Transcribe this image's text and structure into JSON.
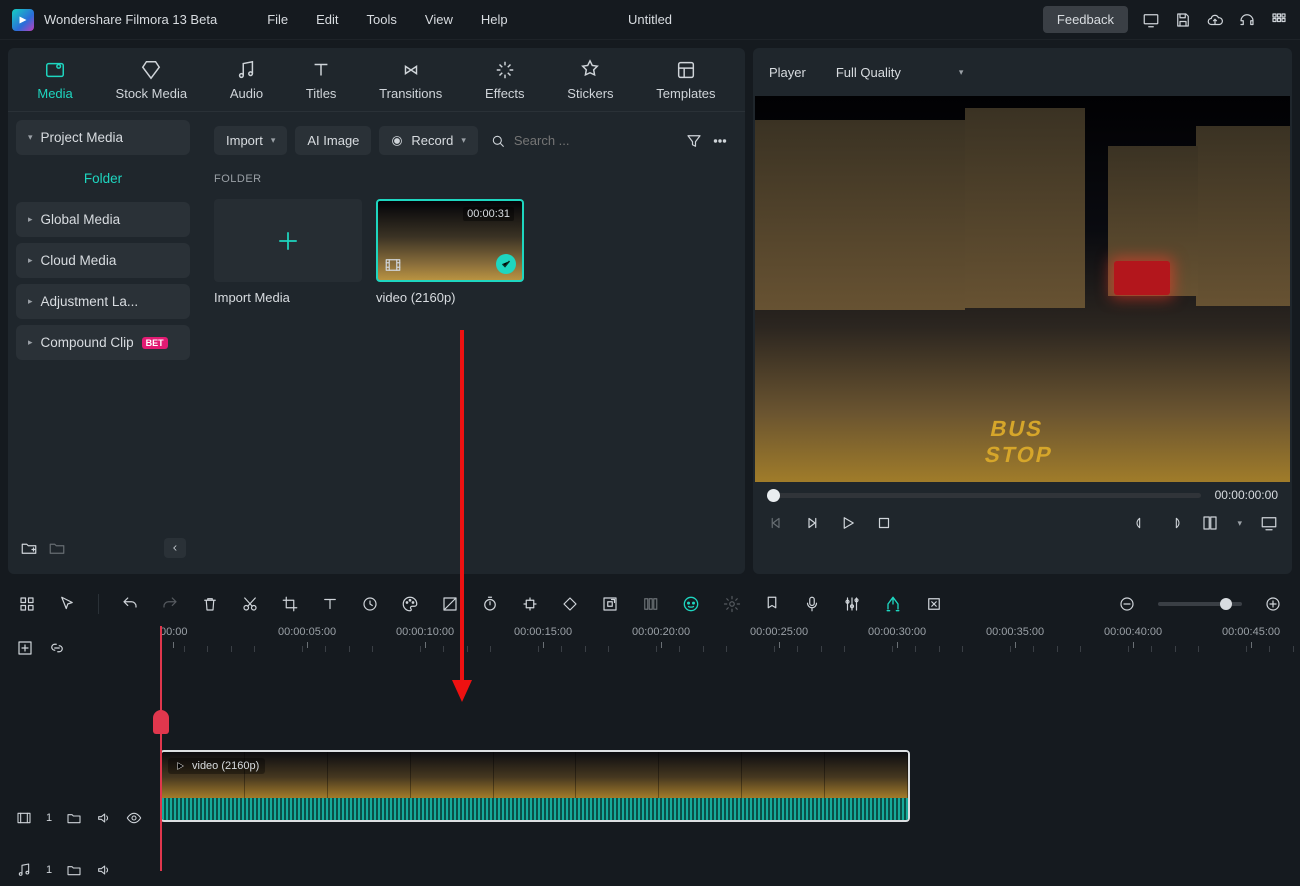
{
  "app_title": "Wondershare Filmora 13 Beta",
  "menus": {
    "file": "File",
    "edit": "Edit",
    "tools": "Tools",
    "view": "View",
    "help": "Help"
  },
  "document_name": "Untitled",
  "feedback_label": "Feedback",
  "tabs": {
    "media": "Media",
    "stock": "Stock Media",
    "audio": "Audio",
    "titles": "Titles",
    "transitions": "Transitions",
    "effects": "Effects",
    "stickers": "Stickers",
    "templates": "Templates"
  },
  "sidebar": {
    "project": "Project Media",
    "folder": "Folder",
    "global": "Global Media",
    "cloud": "Cloud Media",
    "adjust": "Adjustment La...",
    "compound": "Compound Clip",
    "compound_badge": "BET"
  },
  "browser": {
    "import": "Import",
    "ai_image": "AI Image",
    "record": "Record",
    "search_placeholder": "Search ...",
    "section": "FOLDER",
    "import_tile": "Import Media",
    "clip": {
      "duration": "00:00:31",
      "name": "video (2160p)"
    }
  },
  "player": {
    "label": "Player",
    "quality": "Full Quality",
    "timecode": "00:00:00:00",
    "bus_stop": "BUS\nSTOP"
  },
  "ruler": [
    "00:00",
    "00:00:05:00",
    "00:00:10:00",
    "00:00:15:00",
    "00:00:20:00",
    "00:00:25:00",
    "00:00:30:00",
    "00:00:35:00",
    "00:00:40:00",
    "00:00:45:00"
  ],
  "tracks": {
    "video": "1",
    "audio": "1"
  },
  "timeline_clip_label": "video (2160p)"
}
